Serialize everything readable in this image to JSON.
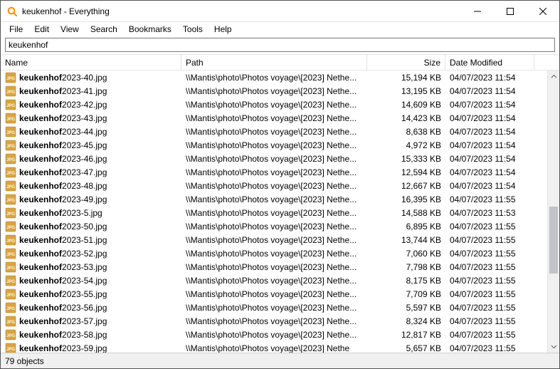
{
  "window": {
    "title": "keukenhof - Everything"
  },
  "menu": {
    "items": [
      "File",
      "Edit",
      "View",
      "Search",
      "Bookmarks",
      "Tools",
      "Help"
    ]
  },
  "search": {
    "value": "keukenhof"
  },
  "columns": {
    "name": "Name",
    "path": "Path",
    "size": "Size",
    "date": "Date Modified"
  },
  "path_display": "\\\\Mantis\\photo\\Photos voyage\\[2023] Nethe...",
  "path_display_last": "\\\\Mantis\\photo\\Photos voyage\\[2023] Nethe",
  "rows": [
    {
      "name_bold": "keukenhof",
      "name_rest": "2023-40.jpg",
      "size": "15,194 KB",
      "date": "04/07/2023 11:54"
    },
    {
      "name_bold": "keukenhof",
      "name_rest": "2023-41.jpg",
      "size": "13,195 KB",
      "date": "04/07/2023 11:54"
    },
    {
      "name_bold": "keukenhof",
      "name_rest": "2023-42.jpg",
      "size": "14,609 KB",
      "date": "04/07/2023 11:54"
    },
    {
      "name_bold": "keukenhof",
      "name_rest": "2023-43.jpg",
      "size": "14,423 KB",
      "date": "04/07/2023 11:54"
    },
    {
      "name_bold": "keukenhof",
      "name_rest": "2023-44.jpg",
      "size": "8,638 KB",
      "date": "04/07/2023 11:54"
    },
    {
      "name_bold": "keukenhof",
      "name_rest": "2023-45.jpg",
      "size": "4,972 KB",
      "date": "04/07/2023 11:54"
    },
    {
      "name_bold": "keukenhof",
      "name_rest": "2023-46.jpg",
      "size": "15,333 KB",
      "date": "04/07/2023 11:54"
    },
    {
      "name_bold": "keukenhof",
      "name_rest": "2023-47.jpg",
      "size": "12,594 KB",
      "date": "04/07/2023 11:54"
    },
    {
      "name_bold": "keukenhof",
      "name_rest": "2023-48.jpg",
      "size": "12,667 KB",
      "date": "04/07/2023 11:54"
    },
    {
      "name_bold": "keukenhof",
      "name_rest": "2023-49.jpg",
      "size": "16,395 KB",
      "date": "04/07/2023 11:55"
    },
    {
      "name_bold": "keukenhof",
      "name_rest": "2023-5.jpg",
      "size": "14,588 KB",
      "date": "04/07/2023 11:53"
    },
    {
      "name_bold": "keukenhof",
      "name_rest": "2023-50.jpg",
      "size": "6,895 KB",
      "date": "04/07/2023 11:55"
    },
    {
      "name_bold": "keukenhof",
      "name_rest": "2023-51.jpg",
      "size": "13,744 KB",
      "date": "04/07/2023 11:55"
    },
    {
      "name_bold": "keukenhof",
      "name_rest": "2023-52.jpg",
      "size": "7,060 KB",
      "date": "04/07/2023 11:55"
    },
    {
      "name_bold": "keukenhof",
      "name_rest": "2023-53.jpg",
      "size": "7,798 KB",
      "date": "04/07/2023 11:55"
    },
    {
      "name_bold": "keukenhof",
      "name_rest": "2023-54.jpg",
      "size": "8,175 KB",
      "date": "04/07/2023 11:55"
    },
    {
      "name_bold": "keukenhof",
      "name_rest": "2023-55.jpg",
      "size": "7,709 KB",
      "date": "04/07/2023 11:55"
    },
    {
      "name_bold": "keukenhof",
      "name_rest": "2023-56.jpg",
      "size": "5,597 KB",
      "date": "04/07/2023 11:55"
    },
    {
      "name_bold": "keukenhof",
      "name_rest": "2023-57.jpg",
      "size": "8,324 KB",
      "date": "04/07/2023 11:55"
    },
    {
      "name_bold": "keukenhof",
      "name_rest": "2023-58.jpg",
      "size": "12,817 KB",
      "date": "04/07/2023 11:55"
    },
    {
      "name_bold": "keukenhof",
      "name_rest": "2023-59.jpg",
      "size": "5,657 KB",
      "date": "04/07/2023 11:55"
    }
  ],
  "status": {
    "text": "79 objects"
  },
  "scrollbar": {
    "thumb_top_pct": 48,
    "thumb_height_pct": 26
  }
}
